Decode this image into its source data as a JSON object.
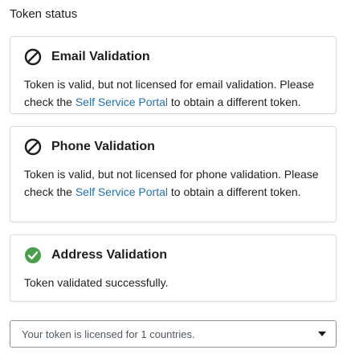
{
  "section": {
    "title": "Token status"
  },
  "cards": [
    {
      "title": "Email Validation",
      "status": "not-licensed",
      "icon": "prohibited-icon",
      "text_before": "Token is valid, but not licensed for email validation. Please check the ",
      "link": "Self Service Portal",
      "text_after": " to obtain a different token."
    },
    {
      "title": "Phone Validation",
      "status": "not-licensed",
      "icon": "prohibited-icon",
      "text_before": "Token is valid, but not licensed for phone validation. Please check the ",
      "link": "Self Service Portal",
      "text_after": " to obtain a different token."
    },
    {
      "title": "Address Validation",
      "status": "valid",
      "icon": "check-circle-icon",
      "text": "Token validated successfully."
    }
  ],
  "countries_select": {
    "value": "Your token is licensed for 1 countries."
  },
  "colors": {
    "link": "#2271b1",
    "success": "#4aa04a",
    "text": "#1e1e1e"
  }
}
